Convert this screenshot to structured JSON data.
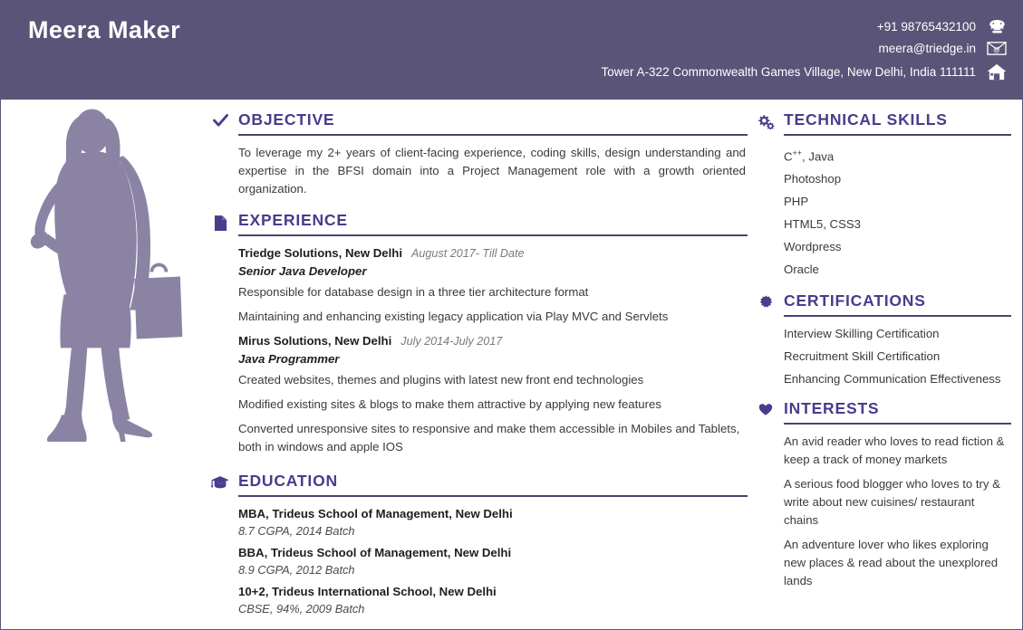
{
  "theme": {
    "header_bg": "#5a5478",
    "heading_color": "#473d8c",
    "rule_color": "#4b4272",
    "silhouette_color": "#8b83a3",
    "body_text": "#3a3a3a"
  },
  "header": {
    "name": "Meera Maker",
    "contacts": [
      {
        "text": "+91 98765432100",
        "icon": "telephone-icon",
        "glyph": "☎"
      },
      {
        "text": "meera@triedge.in",
        "icon": "email-icon",
        "glyph": "✉"
      },
      {
        "text": "Tower A-322 Commonwealth Games Village, New Delhi, India 111111",
        "icon": "home-icon",
        "glyph": "⌂"
      }
    ]
  },
  "photo": {
    "icon": "businesswoman-silhouette"
  },
  "main": {
    "objective": {
      "title": "OBJECTIVE",
      "icon": "checkmark-icon",
      "text": "To leverage my 2+ years of client-facing experience, coding skills, design understanding and expertise in the BFSI domain into a Project Management role with a growth oriented organization."
    },
    "experience": {
      "title": "EXPERIENCE",
      "icon": "document-icon",
      "jobs": [
        {
          "company": "Triedge Solutions, New Delhi",
          "dates": "August 2017- Till Date",
          "role": "Senior Java Developer",
          "bullets": [
            "Responsible for database design in a three tier architecture format",
            "Maintaining and enhancing existing legacy application via Play MVC and Servlets"
          ]
        },
        {
          "company": "Mirus Solutions, New Delhi",
          "dates": "July 2014-July 2017",
          "role": "Java Programmer",
          "bullets": [
            "Created websites, themes and plugins with latest new front end technologies",
            "Modified existing sites & blogs to make them attractive by applying new features",
            "Converted unresponsive sites to responsive and make them accessible in Mobiles and Tablets, both in windows and apple IOS"
          ]
        }
      ]
    },
    "education": {
      "title": "EDUCATION",
      "icon": "graduation-cap-icon",
      "items": [
        {
          "degree": "MBA, Trideus School of Management, New Delhi",
          "detail": "8.7 CGPA, 2014 Batch"
        },
        {
          "degree": "BBA, Trideus School of Management, New Delhi",
          "detail": "8.9 CGPA, 2012 Batch"
        },
        {
          "degree": "10+2, Trideus International School, New Delhi",
          "detail": "CBSE, 94%, 2009 Batch"
        }
      ]
    }
  },
  "sidebar": {
    "technical_skills": {
      "title": "TECHNICAL SKILLS",
      "icon": "gears-icon",
      "items": [
        {
          "base": "C",
          "sup": "++",
          "rest": ", Java"
        },
        {
          "base": "Photoshop",
          "sup": "",
          "rest": ""
        },
        {
          "base": "PHP",
          "sup": "",
          "rest": ""
        },
        {
          "base": "HTML5, CSS3",
          "sup": "",
          "rest": ""
        },
        {
          "base": "Wordpress",
          "sup": "",
          "rest": ""
        },
        {
          "base": "Oracle",
          "sup": "",
          "rest": ""
        }
      ]
    },
    "certifications": {
      "title": "CERTIFICATIONS",
      "icon": "badge-icon",
      "items": [
        "Interview Skilling Certification",
        "Recruitment Skill Certification",
        "Enhancing Communication Effectiveness"
      ]
    },
    "interests": {
      "title": "INTERESTS",
      "icon": "heart-icon",
      "items": [
        "An avid reader who loves to read fiction & keep a track of money markets",
        "A serious food blogger who loves to try & write about new cuisines/ restaurant chains",
        "An adventure lover who likes exploring new places & read about the unexplored lands"
      ]
    }
  }
}
